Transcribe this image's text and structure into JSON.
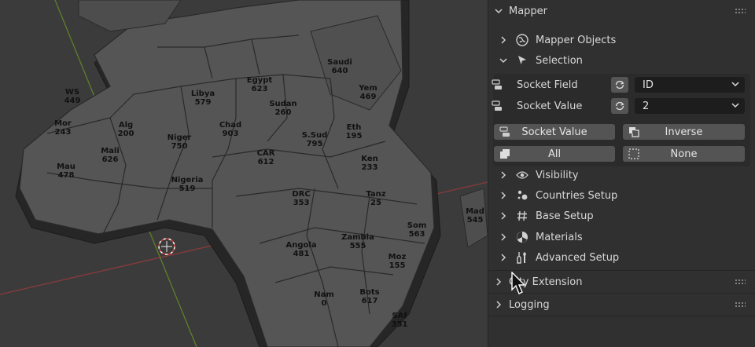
{
  "panel": {
    "title": "Mapper",
    "sections": {
      "mapper_objects": "Mapper Objects",
      "selection": "Selection",
      "visibility": "Visibility",
      "countries_setup": "Countries Setup",
      "base_setup": "Base Setup",
      "materials": "Materials",
      "advanced_setup": "Advanced Setup"
    },
    "selection": {
      "socket_field_label": "Socket Field",
      "socket_field_value": "ID",
      "socket_value_label": "Socket Value",
      "socket_value_value": "2",
      "socket_value_button": "Socket Value",
      "inverse_button": "Inverse",
      "all_button": "All",
      "none_button": "None"
    },
    "extension_title": "City Extension",
    "logging_title": "Logging"
  },
  "map_labels": [
    {
      "name": "Alg",
      "value": "200"
    },
    {
      "name": "Libya",
      "value": "579"
    },
    {
      "name": "Egypt",
      "value": "623"
    },
    {
      "name": "Chad",
      "value": "903"
    },
    {
      "name": "Sudan",
      "value": "260"
    },
    {
      "name": "Niger",
      "value": "750"
    },
    {
      "name": "Mali",
      "value": "626"
    },
    {
      "name": "Mau",
      "value": "478"
    },
    {
      "name": "Nigeria",
      "value": "519"
    },
    {
      "name": "CAR",
      "value": "612"
    },
    {
      "name": "S.Sud",
      "value": "795"
    },
    {
      "name": "Eth",
      "value": "195"
    },
    {
      "name": "Ken",
      "value": "233"
    },
    {
      "name": "DRC",
      "value": "353"
    },
    {
      "name": "Tanz",
      "value": "25"
    },
    {
      "name": "Angola",
      "value": "481"
    },
    {
      "name": "Zambia",
      "value": "555"
    },
    {
      "name": "Moz",
      "value": "155"
    },
    {
      "name": "Nam",
      "value": "0"
    },
    {
      "name": "Bots",
      "value": "617"
    },
    {
      "name": "SAf",
      "value": "351"
    },
    {
      "name": "Mor",
      "value": "243"
    },
    {
      "name": "WS",
      "value": "449"
    },
    {
      "name": "Som",
      "value": "563"
    },
    {
      "name": "Yem",
      "value": "469"
    },
    {
      "name": "Saudi",
      "value": "640"
    },
    {
      "name": "Mad",
      "value": "545"
    }
  ]
}
